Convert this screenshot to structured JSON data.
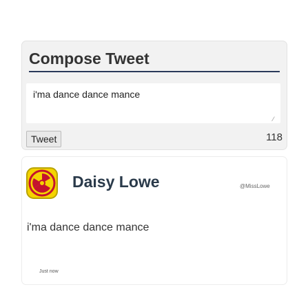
{
  "compose": {
    "title": "Compose Tweet",
    "input_value": "i'ma dance dance mance",
    "button_label": "Tweet",
    "char_count": "118"
  },
  "tweet": {
    "user_name": "Daisy Lowe",
    "handle": "@MissLowe",
    "text": "i'ma dance dance mance",
    "timestamp": "Just now",
    "avatar_icon": "radioactive-icon"
  },
  "colors": {
    "accent": "#2a3a5a",
    "avatar_bg": "#f5d300",
    "avatar_symbol": "#c4122e"
  }
}
